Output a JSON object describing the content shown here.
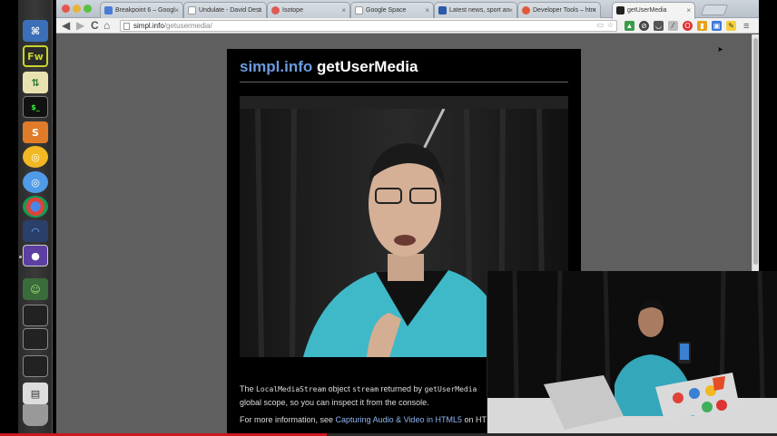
{
  "browser": {
    "tabs": [
      {
        "label": "Breakpoint 6 – Googl",
        "favicon_color": "#4a7bd6"
      },
      {
        "label": "Undulate - David Dest",
        "favicon_color": "#ffffff"
      },
      {
        "label": "Isotope",
        "favicon_color": "#e05a4f"
      },
      {
        "label": "Google Space",
        "favicon_color": "#ffffff"
      },
      {
        "label": "Latest news, sport an",
        "favicon_color": "#2a5aa8"
      },
      {
        "label": "Developer Tools – htm",
        "favicon_color": "#e0583a"
      },
      {
        "label": "getUserMedia",
        "favicon_color": "#222222"
      }
    ],
    "tab_close_glyph": "×",
    "url_host": "simpl.info",
    "url_path": "/getusermedia/",
    "nav": {
      "back": "◀",
      "forward": "▶",
      "reload": "C",
      "home": "⌂"
    },
    "menu_glyph": "≡"
  },
  "page": {
    "title_brand": "simpl.info",
    "title_rest": " getUserMedia",
    "desc_line1_a": "The ",
    "desc_code1": "LocalMediaStream",
    "desc_line1_b": " object ",
    "desc_code2": "stream",
    "desc_line1_c": " returned by ",
    "desc_code3": "getUserMedia",
    "desc_line2": "global scope, so you can inspect it from the console.",
    "desc_line3_a": "For more information, see ",
    "desc_link": "Capturing Audio & Video in HTML5",
    "desc_line3_b": " on HT"
  },
  "dock": {
    "fw_label": "Fw",
    "terminal_label": "$_",
    "sublime_label": "S"
  },
  "video_progress": 0.42,
  "colors": {
    "accent_link": "#6b9be0",
    "progress": "#cc181e"
  }
}
